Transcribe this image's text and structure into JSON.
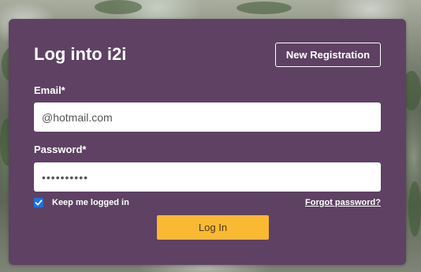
{
  "login": {
    "title": "Log into i2i",
    "new_registration_label": "New Registration",
    "email_label": "Email*",
    "email_value": "@hotmail.com",
    "password_label": "Password*",
    "password_value": "••••••••••",
    "keep_logged_in_label": "Keep me logged in",
    "keep_logged_in_checked": true,
    "forgot_password_label": "Forgot password?",
    "login_button_label": "Log In"
  },
  "colors": {
    "card_background": "#5e4163",
    "login_button": "#f9b932",
    "checkbox_accent": "#1a73e8"
  }
}
